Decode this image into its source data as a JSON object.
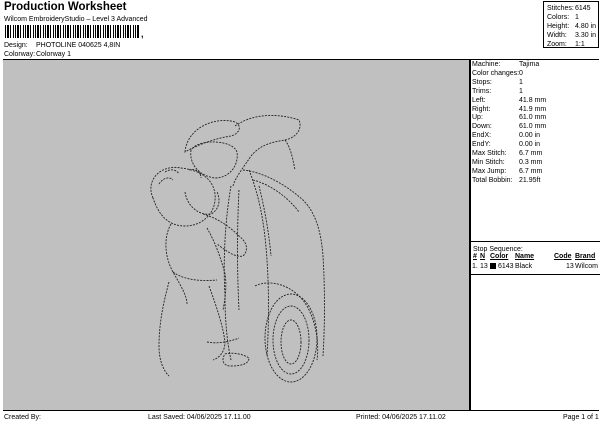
{
  "header": {
    "title": "Production Worksheet",
    "subtitle": "Wilcom EmbroideryStudio – Level 3 Advanced",
    "barcode_suffix": ","
  },
  "design_info": {
    "design_label": "Design:",
    "design_value": "PHOTOLINE 040625 4,8IN",
    "colorway_label": "Colorway:",
    "colorway_value": "Colorway 1"
  },
  "stats": {
    "stitches_label": "Stitches:",
    "stitches_value": "6145",
    "colors_label": "Colors:",
    "colors_value": "1",
    "height_label": "Height:",
    "height_value": "4.80 in",
    "width_label": "Width:",
    "width_value": "3.30 in",
    "zoom_label": "Zoom:",
    "zoom_value": "1:1"
  },
  "canvas": {
    "background": "#c0c0c0"
  },
  "machine_info": [
    {
      "label": "Machine:",
      "value": "Tajima"
    },
    {
      "label": "Color changes:",
      "value": "0"
    },
    {
      "label": "Stops:",
      "value": "1"
    },
    {
      "label": "Trims:",
      "value": "1"
    },
    {
      "label": "Left:",
      "value": "41.8 mm"
    },
    {
      "label": "Right:",
      "value": "41.9 mm"
    },
    {
      "label": "Up:",
      "value": "61.0 mm"
    },
    {
      "label": "Down:",
      "value": "61.0 mm"
    },
    {
      "label": "EndX:",
      "value": "0.00 in"
    },
    {
      "label": "EndY:",
      "value": "0.00 in"
    },
    {
      "label": "Max Stitch:",
      "value": "6.7 mm"
    },
    {
      "label": "Min Stitch:",
      "value": "0.3 mm"
    },
    {
      "label": "Max Jump:",
      "value": "6.7 mm"
    },
    {
      "label": "Total Bobbin:",
      "value": "21.95ft"
    }
  ],
  "stop_sequence": {
    "title": "Stop Sequence:",
    "columns": [
      "#",
      "N",
      "Color",
      "Name",
      "Code",
      "Brand"
    ],
    "rows": [
      {
        "index": "1.",
        "n": "13",
        "stitches": "6143",
        "name": "Black",
        "code": "13",
        "brand": "Wilcom",
        "swatch": "#000000"
      }
    ]
  },
  "footer": {
    "created_by": "Created By:",
    "last_saved": "Last Saved: 04/06/2025 17.11.00",
    "printed": "Printed: 04/06/2025 17.11.02",
    "page": "Page 1 of 1"
  }
}
